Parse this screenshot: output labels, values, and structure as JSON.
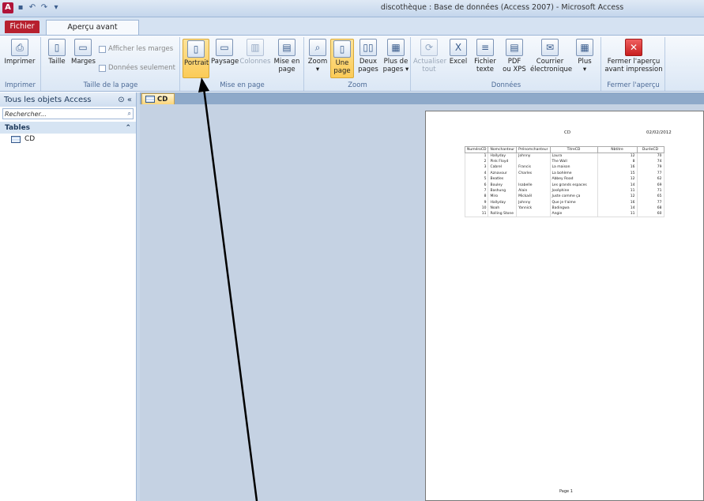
{
  "window": {
    "title": "discothèque : Base de données (Access 2007) - Microsoft Access"
  },
  "tabs": {
    "file": "Fichier",
    "active": "Aperçu avant impression"
  },
  "ribbon": {
    "imprimer_group": {
      "label": "Imprimer",
      "print": "Imprimer"
    },
    "taille_group": {
      "label": "Taille de la page",
      "taille": "Taille",
      "marges": "Marges",
      "afficher_marges": "Afficher les marges",
      "donnees_seulement": "Données seulement"
    },
    "mise_en_page_group": {
      "label": "Mise en page",
      "portrait": "Portrait",
      "paysage": "Paysage",
      "colonnes": "Colonnes",
      "mise_en_page_1": "Mise en",
      "mise_en_page_2": "page"
    },
    "zoom_group": {
      "label": "Zoom",
      "zoom": "Zoom",
      "une_page_1": "Une",
      "une_page_2": "page",
      "deux_pages_1": "Deux",
      "deux_pages_2": "pages",
      "plus_pages_1": "Plus de",
      "plus_pages_2": "pages ▾"
    },
    "donnees_group": {
      "label": "Données",
      "actualiser_1": "Actualiser",
      "actualiser_2": "tout",
      "excel": "Excel",
      "fichier_texte_1": "Fichier",
      "fichier_texte_2": "texte",
      "pdf_1": "PDF",
      "pdf_2": "ou XPS",
      "courrier_1": "Courrier",
      "courrier_2": "électronique",
      "plus": "Plus"
    },
    "fermer_group": {
      "label": "Fermer l'aperçu",
      "fermer_1": "Fermer l'aperçu",
      "fermer_2": "avant impression"
    }
  },
  "nav": {
    "header": "Tous les objets Access",
    "search_placeholder": "Rechercher...",
    "section": "Tables",
    "items": [
      {
        "label": "CD"
      }
    ]
  },
  "document_tab": {
    "label": "CD"
  },
  "report": {
    "title": "CD",
    "date": "02/02/2012",
    "columns": [
      "NuméroCD",
      "Nomchanteur",
      "Prénomchanteur",
      "TitreCD",
      "Nbtitre",
      "DuréeCD"
    ],
    "rows": [
      [
        "1",
        "Hallyday",
        "Johnny",
        "Laura",
        "12",
        "70"
      ],
      [
        "2",
        "Pink Floyd",
        "",
        "The Wall",
        "8",
        "74"
      ],
      [
        "3",
        "Cabrel",
        "Francis",
        "La maison",
        "16",
        "79"
      ],
      [
        "4",
        "Aznavour",
        "Charles",
        "La bohème",
        "15",
        "77"
      ],
      [
        "5",
        "Beatles",
        "",
        "Abbey Road",
        "12",
        "62"
      ],
      [
        "6",
        "Bouley",
        "Isabelle",
        "Les grands espaces",
        "14",
        "69"
      ],
      [
        "7",
        "Bashung",
        "Alain",
        "Joséphine",
        "11",
        "71"
      ],
      [
        "8",
        "Miro",
        "Mickaël",
        "Juste comme ça",
        "12",
        "65"
      ],
      [
        "9",
        "Hallyday",
        "Johnny",
        "Que je t'aime",
        "16",
        "77"
      ],
      [
        "10",
        "Noah",
        "Yannick",
        "Badingwa",
        "14",
        "68"
      ],
      [
        "11",
        "Rolling Stone",
        "",
        "Angie",
        "11",
        "60"
      ]
    ],
    "footer": "Page 1"
  }
}
